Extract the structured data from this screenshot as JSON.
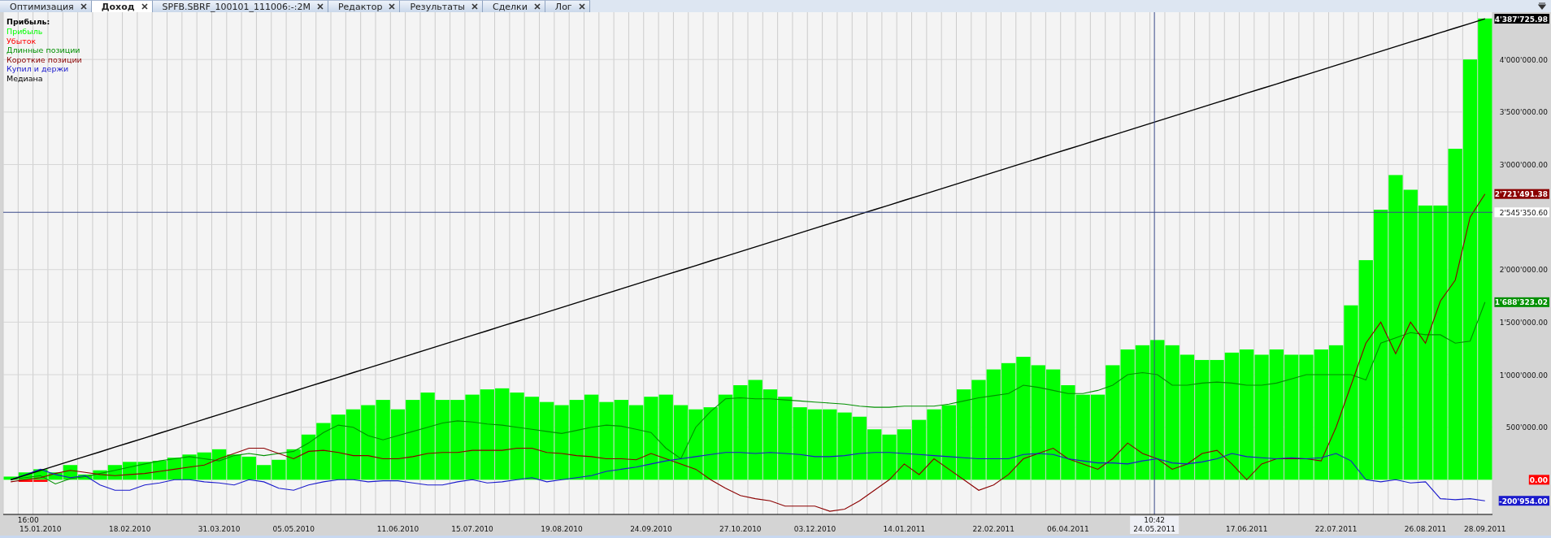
{
  "tabs": [
    {
      "label": "Оптимизация",
      "selected": false
    },
    {
      "label": "Доход",
      "selected": true
    },
    {
      "label": "SPFB.SBRF_100101_111006:-:2M",
      "selected": false
    },
    {
      "label": "Редактор",
      "selected": false
    },
    {
      "label": "Результаты",
      "selected": false
    },
    {
      "label": "Сделки",
      "selected": false
    },
    {
      "label": "Лог",
      "selected": false
    }
  ],
  "chart": {
    "start_time": "16:00",
    "crosshair": {
      "time": "10:42",
      "date": "24.05.2011",
      "level": 0.773
    },
    "value_labels": [
      {
        "text": "4'387'725.98",
        "color": "#000000"
      },
      {
        "text": "2'721'491.38",
        "color": "#8b0000"
      },
      {
        "text": "1'688'323.02",
        "color": "#009000"
      },
      {
        "text": "0.00",
        "color": "#ff0000"
      },
      {
        "text": "-200'954.00",
        "color": "#1a1acc"
      }
    ],
    "chart_data": {
      "type": "bar",
      "title": "Прибыль:",
      "grid": true,
      "ylim": [
        -330000,
        4450000
      ],
      "categories": [
        null,
        null,
        "15.01.2010",
        null,
        null,
        null,
        null,
        null,
        "18.02.2010",
        null,
        null,
        null,
        null,
        null,
        "31.03.2010",
        null,
        null,
        null,
        null,
        "05.05.2010",
        null,
        null,
        null,
        null,
        null,
        null,
        "11.06.2010",
        null,
        null,
        null,
        null,
        "15.07.2010",
        null,
        null,
        null,
        null,
        null,
        "19.08.2010",
        null,
        null,
        null,
        null,
        null,
        "24.09.2010",
        null,
        null,
        null,
        null,
        null,
        "27.10.2010",
        null,
        null,
        null,
        null,
        "03.12.2010",
        null,
        null,
        null,
        null,
        null,
        "14.01.2011",
        null,
        null,
        null,
        null,
        null,
        "22.02.2011",
        null,
        null,
        null,
        null,
        "06.04.2011",
        null,
        null,
        null,
        null,
        null,
        null,
        null,
        null,
        null,
        null,
        null,
        "17.06.2011",
        null,
        null,
        null,
        null,
        null,
        "22.07.2011",
        null,
        null,
        null,
        null,
        null,
        "26.08.2011",
        null,
        null,
        null,
        "28.09.2011"
      ],
      "yticks": [
        {
          "value": 500000,
          "label": "500'000.00"
        },
        {
          "value": 1000000,
          "label": "1'000'000.00"
        },
        {
          "value": 1500000,
          "label": "1'500'000.00"
        },
        {
          "value": 2000000,
          "label": "2'000'000.00"
        },
        {
          "value": 3000000,
          "label": "3'000'000.00"
        },
        {
          "value": 3500000,
          "label": "3'500'000.00"
        },
        {
          "value": 4000000,
          "label": "4'000'000.00"
        }
      ],
      "series": [
        {
          "name": "Прибыль",
          "type": "bar",
          "color": "#00ff00",
          "values": [
            30000,
            70000,
            100000,
            70000,
            140000,
            50000,
            90000,
            140000,
            170000,
            170000,
            180000,
            210000,
            240000,
            260000,
            290000,
            240000,
            220000,
            140000,
            190000,
            290000,
            430000,
            540000,
            620000,
            670000,
            710000,
            760000,
            670000,
            760000,
            830000,
            760000,
            760000,
            810000,
            860000,
            870000,
            830000,
            790000,
            740000,
            710000,
            760000,
            810000,
            740000,
            760000,
            710000,
            790000,
            810000,
            710000,
            670000,
            690000,
            810000,
            900000,
            950000,
            860000,
            790000,
            690000,
            670000,
            670000,
            640000,
            600000,
            480000,
            430000,
            480000,
            570000,
            670000,
            710000,
            860000,
            950000,
            1050000,
            1110000,
            1170000,
            1090000,
            1050000,
            900000,
            810000,
            810000,
            1090000,
            1240000,
            1280000,
            1330000,
            1280000,
            1190000,
            1140000,
            1140000,
            1210000,
            1240000,
            1190000,
            1240000,
            1190000,
            1190000,
            1240000,
            1280000,
            1660000,
            2090000,
            2570000,
            2900000,
            2760000,
            2610000,
            2610000,
            3150000,
            4000000,
            4390000
          ]
        },
        {
          "name": "Убыток",
          "type": "bar",
          "color": "#ff0000",
          "values": [
            0,
            -20000,
            -20000,
            0,
            0,
            0,
            0,
            0,
            0,
            0,
            0,
            0,
            0,
            0,
            0,
            0,
            0,
            0,
            0,
            0,
            0,
            0,
            0,
            0,
            0,
            0,
            0,
            0,
            0,
            0,
            0,
            0,
            0,
            0,
            0,
            0,
            0,
            0,
            0,
            0,
            0,
            0,
            0,
            0,
            0,
            0,
            0,
            0,
            0,
            0,
            0,
            0,
            0,
            0,
            0,
            0,
            0,
            0,
            0,
            0,
            0,
            0,
            0,
            0,
            0,
            0,
            0,
            0,
            0,
            0,
            0,
            0,
            0,
            0,
            0,
            0,
            0,
            0,
            0,
            0,
            0,
            0,
            0,
            0,
            0,
            0,
            0,
            0,
            0,
            0,
            0,
            0,
            0,
            0,
            0,
            0,
            0,
            0,
            0,
            0
          ]
        },
        {
          "name": "Длинные позиции",
          "type": "line",
          "color": "#009000",
          "values": [
            0,
            20000,
            40000,
            -40000,
            10000,
            30000,
            60000,
            90000,
            120000,
            150000,
            180000,
            200000,
            220000,
            200000,
            180000,
            230000,
            250000,
            230000,
            250000,
            270000,
            350000,
            450000,
            520000,
            500000,
            420000,
            380000,
            420000,
            460000,
            500000,
            540000,
            560000,
            550000,
            530000,
            520000,
            500000,
            480000,
            460000,
            440000,
            470000,
            500000,
            520000,
            510000,
            480000,
            450000,
            300000,
            200000,
            500000,
            650000,
            770000,
            780000,
            770000,
            770000,
            760000,
            750000,
            740000,
            730000,
            720000,
            700000,
            690000,
            690000,
            700000,
            700000,
            700000,
            720000,
            750000,
            780000,
            800000,
            820000,
            900000,
            880000,
            850000,
            820000,
            820000,
            850000,
            900000,
            1000000,
            1020000,
            1000000,
            900000,
            900000,
            920000,
            930000,
            920000,
            900000,
            900000,
            920000,
            960000,
            1000000,
            1000000,
            1000000,
            1000000,
            950000,
            1300000,
            1350000,
            1400000,
            1380000,
            1380000,
            1300000,
            1320000,
            1690000
          ]
        },
        {
          "name": "Короткие позиции",
          "type": "line",
          "color": "#8b0000",
          "values": [
            -20000,
            0,
            20000,
            60000,
            90000,
            70000,
            50000,
            40000,
            50000,
            60000,
            80000,
            100000,
            120000,
            140000,
            200000,
            250000,
            300000,
            300000,
            250000,
            200000,
            270000,
            280000,
            260000,
            230000,
            230000,
            200000,
            200000,
            220000,
            250000,
            260000,
            260000,
            280000,
            280000,
            280000,
            300000,
            300000,
            260000,
            250000,
            230000,
            220000,
            200000,
            200000,
            190000,
            250000,
            200000,
            150000,
            100000,
            0,
            -80000,
            -150000,
            -180000,
            -200000,
            -250000,
            -250000,
            -250000,
            -300000,
            -280000,
            -200000,
            -100000,
            0,
            150000,
            50000,
            200000,
            100000,
            0,
            -100000,
            -50000,
            50000,
            200000,
            250000,
            300000,
            200000,
            150000,
            100000,
            200000,
            350000,
            250000,
            200000,
            100000,
            150000,
            250000,
            280000,
            150000,
            0,
            150000,
            200000,
            200000,
            200000,
            180000,
            500000,
            900000,
            1300000,
            1500000,
            1200000,
            1500000,
            1300000,
            1700000,
            1900000,
            2500000,
            2720000
          ]
        },
        {
          "name": "Купил и держи",
          "type": "line",
          "color": "#1a1acc",
          "values": [
            0,
            50000,
            100000,
            50000,
            20000,
            40000,
            -50000,
            -100000,
            -100000,
            -50000,
            -30000,
            0,
            0,
            -20000,
            -30000,
            -50000,
            0,
            -20000,
            -80000,
            -100000,
            -50000,
            -20000,
            0,
            0,
            -20000,
            -10000,
            -10000,
            -30000,
            -50000,
            -50000,
            -20000,
            0,
            -30000,
            -20000,
            0,
            20000,
            -20000,
            0,
            20000,
            40000,
            80000,
            100000,
            120000,
            150000,
            180000,
            200000,
            220000,
            240000,
            260000,
            260000,
            250000,
            260000,
            250000,
            240000,
            220000,
            220000,
            230000,
            250000,
            260000,
            260000,
            250000,
            240000,
            230000,
            220000,
            210000,
            200000,
            200000,
            200000,
            240000,
            250000,
            240000,
            200000,
            180000,
            160000,
            160000,
            150000,
            180000,
            200000,
            160000,
            150000,
            170000,
            200000,
            250000,
            220000,
            210000,
            200000,
            210000,
            200000,
            210000,
            250000,
            180000,
            0,
            -20000,
            0,
            -30000,
            -20000,
            -180000,
            -190000,
            -180000,
            -200000
          ]
        },
        {
          "name": "Медиана",
          "type": "line",
          "color": "#000000",
          "values": [
            0,
            44320,
            88640,
            132960,
            177280,
            221600,
            265920,
            310240,
            354560,
            398880,
            443200,
            487520,
            531840,
            576160,
            620480,
            664800,
            709120,
            753440,
            797760,
            842080,
            886400,
            930720,
            975040,
            1019360,
            1063680,
            1108000,
            1152320,
            1196640,
            1240960,
            1285280,
            1329600,
            1373920,
            1418240,
            1462560,
            1506880,
            1551200,
            1595520,
            1639840,
            1684160,
            1728480,
            1772800,
            1817120,
            1861440,
            1905760,
            1950080,
            1994400,
            2038720,
            2083040,
            2127360,
            2171680,
            2216000,
            2260320,
            2304640,
            2348960,
            2393280,
            2437600,
            2481920,
            2526240,
            2570560,
            2614880,
            2659200,
            2703520,
            2747840,
            2792160,
            2836480,
            2880800,
            2925120,
            2969440,
            3013760,
            3058080,
            3102400,
            3146720,
            3191040,
            3235360,
            3279680,
            3324000,
            3368320,
            3412640,
            3456960,
            3501280,
            3545600,
            3589920,
            3634240,
            3678560,
            3722880,
            3767200,
            3811520,
            3855840,
            3900160,
            3944480,
            3988800,
            4033120,
            4077440,
            4121760,
            4166080,
            4210400,
            4254720,
            4299040,
            4343360,
            4387700
          ]
        }
      ],
      "ref_lines": [
        {
          "axis": "y",
          "value": 2545350.6,
          "label": "2'545'350.60"
        }
      ]
    }
  }
}
